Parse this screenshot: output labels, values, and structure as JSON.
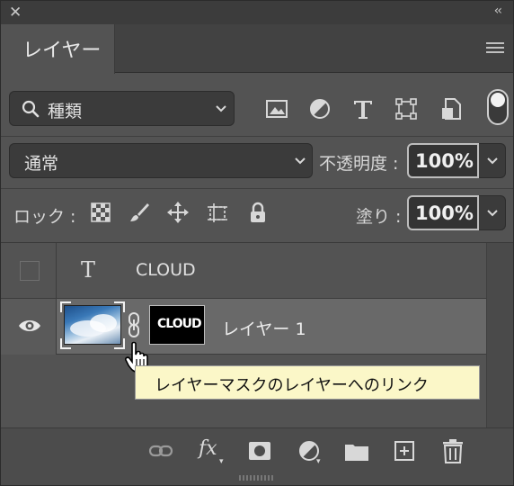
{
  "panel": {
    "tab_label": "レイヤー"
  },
  "filter": {
    "kind_label": "種類",
    "icons": [
      "image-filter-icon",
      "adjustment-filter-icon",
      "type-filter-icon",
      "shape-filter-icon",
      "smart-object-filter-icon",
      "filter-toggle"
    ]
  },
  "blend": {
    "mode": "通常",
    "opacity_label": "不透明度 :",
    "opacity_value": "100%"
  },
  "lock": {
    "label": "ロック :",
    "icons": [
      "lock-transparent-pixels-icon",
      "lock-image-pixels-icon",
      "lock-position-icon",
      "lock-artboard-icon",
      "lock-all-icon"
    ],
    "fill_label": "塗り :",
    "fill_value": "100%"
  },
  "layers": [
    {
      "name": "CLOUD",
      "type": "text",
      "visible": false,
      "selected": false
    },
    {
      "name": "レイヤー 1",
      "type": "pixel",
      "visible": true,
      "selected": true,
      "mask_text": "CLOUD"
    }
  ],
  "tooltip": {
    "text": "レイヤーマスクのレイヤーへのリンク"
  },
  "bottom_toolbar": {
    "icons": [
      "link-layers-icon",
      "fx-icon",
      "add-mask-icon",
      "adjustment-layer-icon",
      "new-group-icon",
      "new-layer-icon",
      "delete-icon"
    ],
    "fx_label": "fx"
  },
  "colors": {
    "panel_bg": "#535353",
    "selected_row": "#696969",
    "tooltip_bg": "#fbf7c8"
  }
}
